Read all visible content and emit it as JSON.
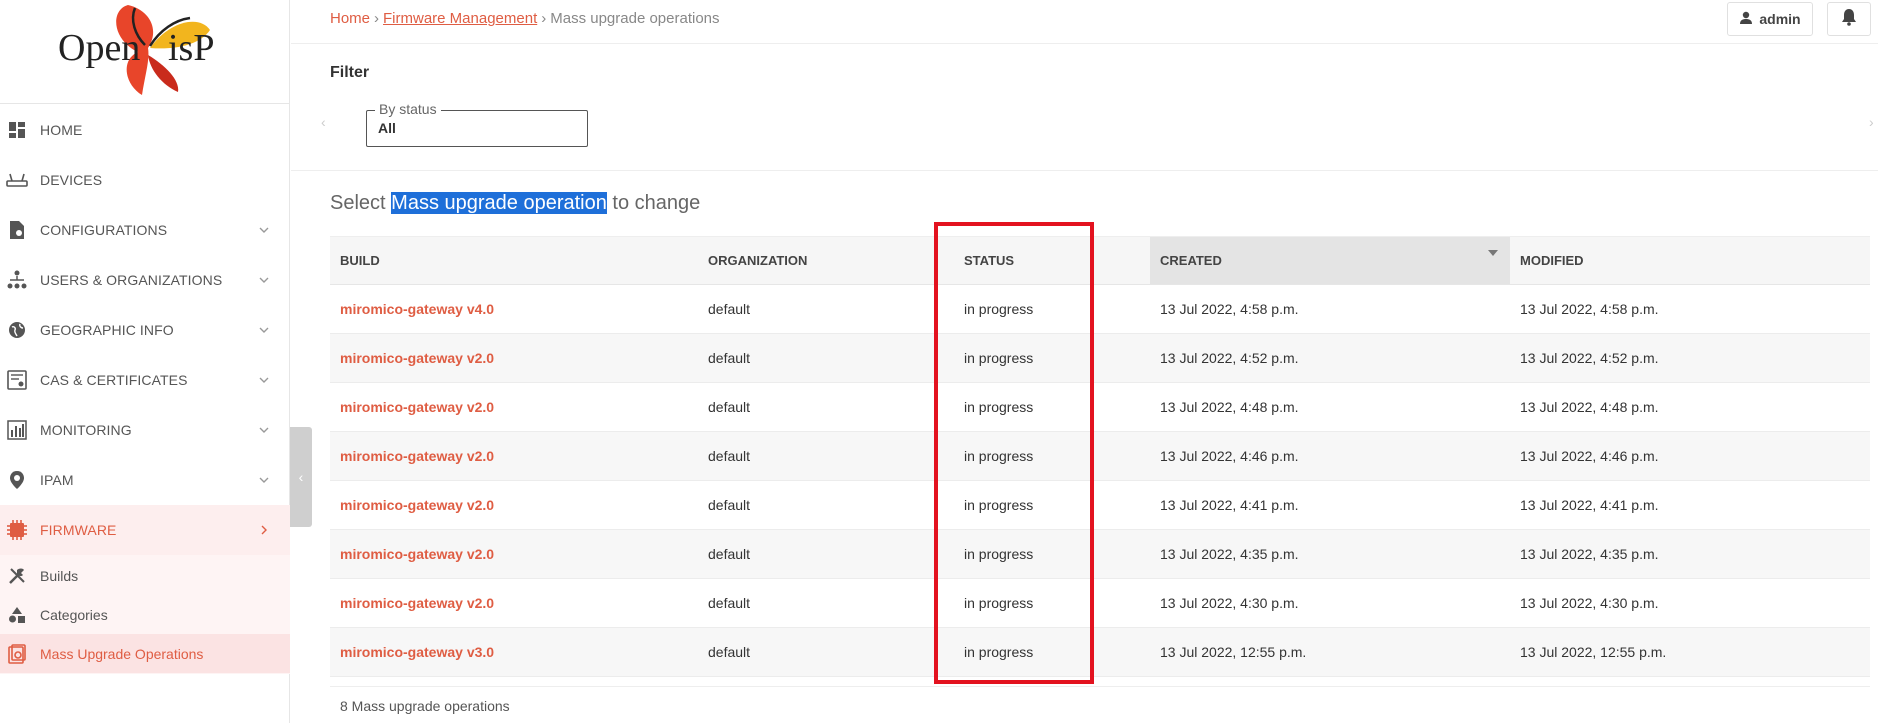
{
  "brand": {
    "logo_text": "OpenWisP",
    "accent_color": "#df5d43"
  },
  "sidebar": {
    "items": [
      {
        "label": "HOME",
        "icon": "dashboard-icon",
        "has_chevron": false
      },
      {
        "label": "DEVICES",
        "icon": "router-icon",
        "has_chevron": false
      },
      {
        "label": "CONFIGURATIONS",
        "icon": "config-file-icon",
        "has_chevron": true
      },
      {
        "label": "USERS & ORGANIZATIONS",
        "icon": "org-tree-icon",
        "has_chevron": true
      },
      {
        "label": "GEOGRAPHIC INFO",
        "icon": "globe-icon",
        "has_chevron": true
      },
      {
        "label": "CAS & CERTIFICATES",
        "icon": "certificate-icon",
        "has_chevron": true
      },
      {
        "label": "MONITORING",
        "icon": "bar-chart-icon",
        "has_chevron": true
      },
      {
        "label": "IPAM",
        "icon": "map-pin-icon",
        "has_chevron": true
      },
      {
        "label": "FIRMWARE",
        "icon": "chip-icon",
        "has_chevron": true,
        "active": true
      }
    ],
    "firmware_sub": [
      {
        "label": "Builds",
        "icon": "tools-icon"
      },
      {
        "label": "Categories",
        "icon": "shapes-icon"
      },
      {
        "label": "Mass Upgrade Operations",
        "icon": "upgrade-icon",
        "active": true
      }
    ]
  },
  "breadcrumb": {
    "home": "Home",
    "sep1": "›",
    "section": "Firmware Management",
    "sep2": "›",
    "current": "Mass upgrade operations"
  },
  "user_menu": {
    "username": "admin"
  },
  "filter": {
    "title": "Filter",
    "legend": "By status",
    "value": "All"
  },
  "page": {
    "heading_prefix": "Select ",
    "heading_highlight": "Mass upgrade operation",
    "heading_suffix": " to change",
    "result_count": "8 Mass upgrade operations"
  },
  "table": {
    "columns": [
      "BUILD",
      "ORGANIZATION",
      "STATUS",
      "CREATED",
      "MODIFIED"
    ],
    "rows": [
      [
        "miromico-gateway v4.0",
        "default",
        "in progress",
        "13 Jul 2022, 4:58 p.m.",
        "13 Jul 2022, 4:58 p.m."
      ],
      [
        "miromico-gateway v2.0",
        "default",
        "in progress",
        "13 Jul 2022, 4:52 p.m.",
        "13 Jul 2022, 4:52 p.m."
      ],
      [
        "miromico-gateway v2.0",
        "default",
        "in progress",
        "13 Jul 2022, 4:48 p.m.",
        "13 Jul 2022, 4:48 p.m."
      ],
      [
        "miromico-gateway v2.0",
        "default",
        "in progress",
        "13 Jul 2022, 4:46 p.m.",
        "13 Jul 2022, 4:46 p.m."
      ],
      [
        "miromico-gateway v2.0",
        "default",
        "in progress",
        "13 Jul 2022, 4:41 p.m.",
        "13 Jul 2022, 4:41 p.m."
      ],
      [
        "miromico-gateway v2.0",
        "default",
        "in progress",
        "13 Jul 2022, 4:35 p.m.",
        "13 Jul 2022, 4:35 p.m."
      ],
      [
        "miromico-gateway v2.0",
        "default",
        "in progress",
        "13 Jul 2022, 4:30 p.m.",
        "13 Jul 2022, 4:30 p.m."
      ],
      [
        "miromico-gateway v3.0",
        "default",
        "in progress",
        "13 Jul 2022, 12:55 p.m.",
        "13 Jul 2022, 12:55 p.m."
      ]
    ]
  },
  "annotation": {
    "color": "#e3121f"
  }
}
